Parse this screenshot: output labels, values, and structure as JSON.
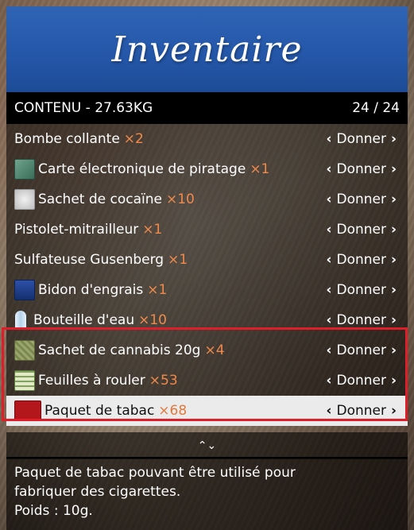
{
  "menu": {
    "title": "Inventaire",
    "subheader": {
      "left": "CONTENU - 27.63KG",
      "right": "24 / 24"
    },
    "action_label": "Donner",
    "arrow_left": "‹",
    "arrow_right": "›",
    "items": [
      {
        "name": "Bombe collante",
        "qty": "×2",
        "icon": ""
      },
      {
        "name": "Carte électronique de piratage",
        "qty": "×1",
        "icon": "keycard-icon"
      },
      {
        "name": "Sachet de cocaïne",
        "qty": "×10",
        "icon": "cocaine-bag-icon"
      },
      {
        "name": "Pistolet-mitrailleur",
        "qty": "×1",
        "icon": ""
      },
      {
        "name": "Sulfateuse Gusenberg",
        "qty": "×1",
        "icon": ""
      },
      {
        "name": "Bidon d'engrais",
        "qty": "×1",
        "icon": "fertilizer-can-icon"
      },
      {
        "name": "Bouteille d'eau",
        "qty": "×10",
        "icon": "water-bottle-icon"
      },
      {
        "name": "Sachet de cannabis 20g",
        "qty": "×4",
        "icon": "cannabis-bag-icon"
      },
      {
        "name": "Feuilles à rouler",
        "qty": "×53",
        "icon": "rolling-papers-icon"
      },
      {
        "name": "Paquet de tabac",
        "qty": "×68",
        "icon": "tobacco-pack-icon",
        "selected": true
      }
    ],
    "scroll_icon": "⌃⌄"
  },
  "description": {
    "line1": "Paquet de tabac pouvant être utilisé pour",
    "line2": "fabriquer des cigarettes.",
    "line3": "Poids : 10g."
  },
  "colors": {
    "banner": "#2456a8",
    "quantity": "#f08a4c",
    "highlight": "#e01e2a",
    "selected_row": "#ebebeb"
  }
}
